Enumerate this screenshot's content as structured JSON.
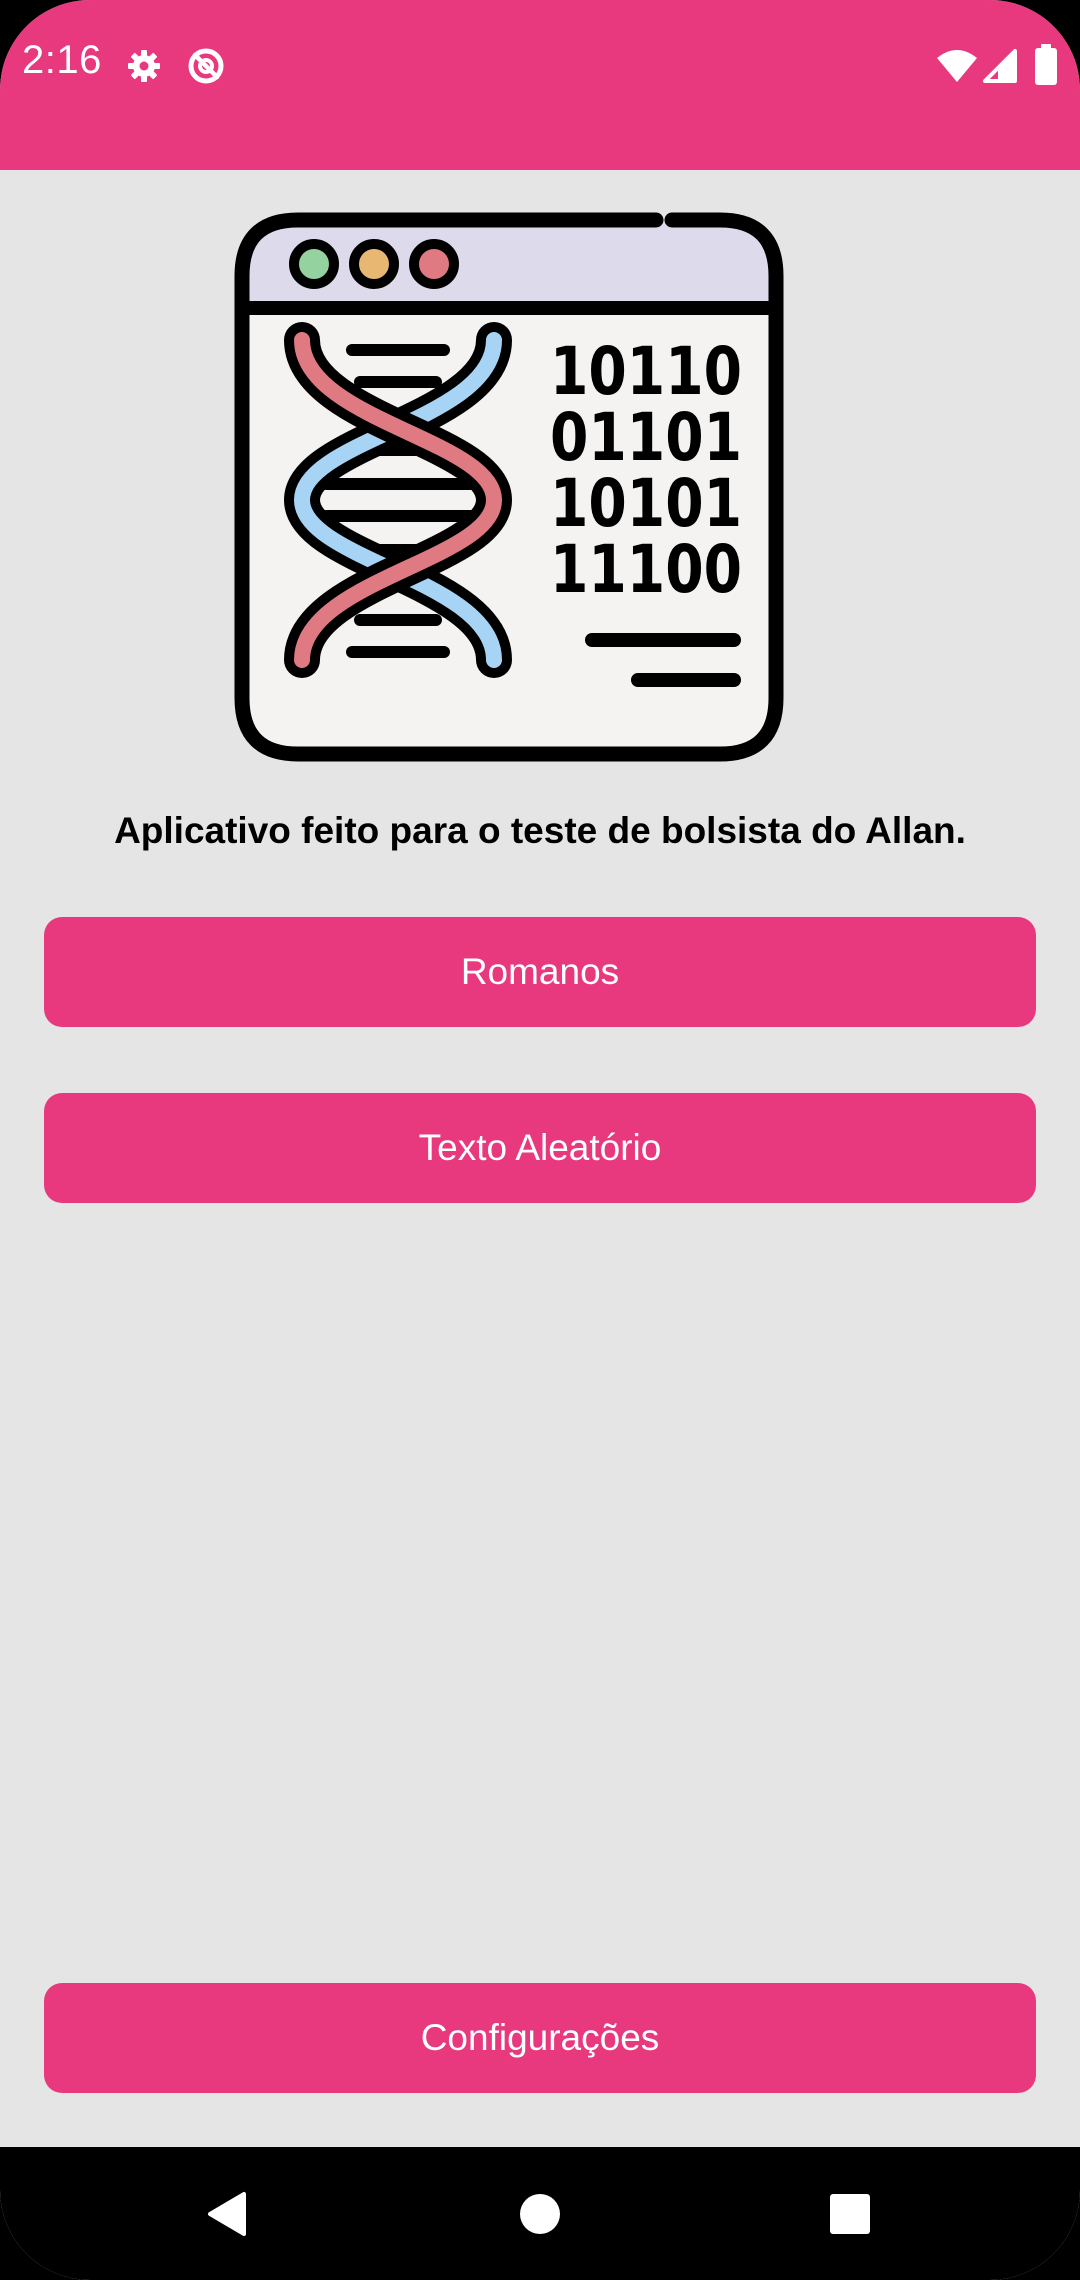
{
  "status_bar": {
    "time": "2:16",
    "left_icons": [
      "settings-icon",
      "do-not-disturb-icon"
    ],
    "right_icons": [
      "wifi-icon",
      "signal-icon",
      "battery-icon"
    ],
    "color": "#E8387E"
  },
  "main": {
    "illustration": "dna-binary-icon",
    "description": "Aplicativo feito para o teste de bolsista do Allan.",
    "buttons": {
      "romanos": "Romanos",
      "texto_aleatorio": "Texto Aleatório",
      "configuracoes": "Configurações"
    },
    "accent": "#E8387E",
    "background": "#E6E5E6"
  },
  "nav_bar": {
    "buttons": [
      "back-icon",
      "home-icon",
      "recents-icon"
    ]
  }
}
